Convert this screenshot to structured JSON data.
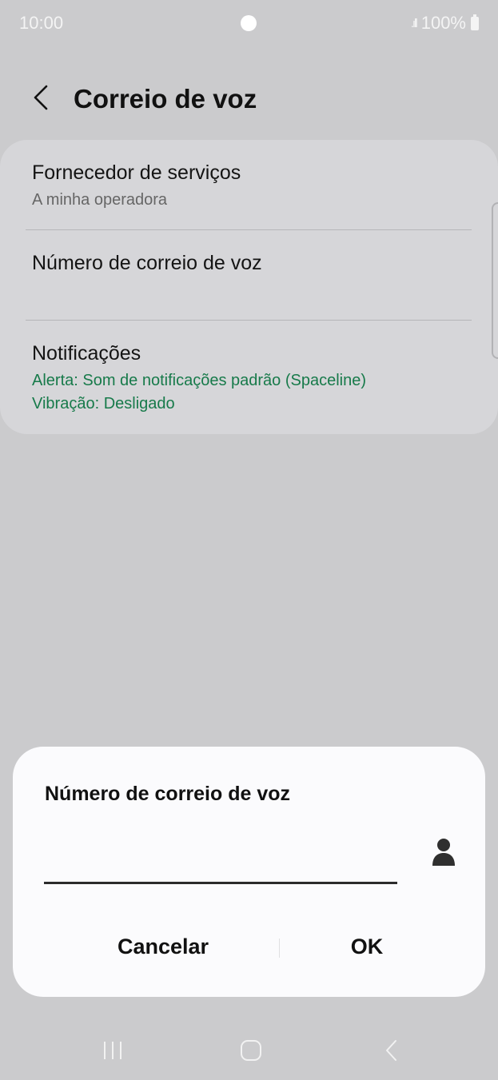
{
  "status_bar": {
    "time": "10:00",
    "battery": "100%"
  },
  "header": {
    "title": "Correio de voz"
  },
  "settings": [
    {
      "title": "Fornecedor de serviços",
      "subtitle": "A minha operadora"
    },
    {
      "title": "Número de correio de voz"
    },
    {
      "title": "Notificações",
      "lines": [
        "Alerta: Som de notificações padrão (Spaceline)",
        "Vibração: Desligado"
      ]
    }
  ],
  "dialog": {
    "title": "Número de correio de voz",
    "input_value": "",
    "cancel_label": "Cancelar",
    "ok_label": "OK"
  },
  "colors": {
    "accent_green": "#177a4a",
    "background": "#cbcbcd",
    "dialog_bg": "#fbfbfd"
  },
  "icons": [
    "back-arrow-icon",
    "contact-icon",
    "recents-icon",
    "home-icon",
    "nav-back-icon",
    "battery-icon",
    "signal-icon"
  ]
}
